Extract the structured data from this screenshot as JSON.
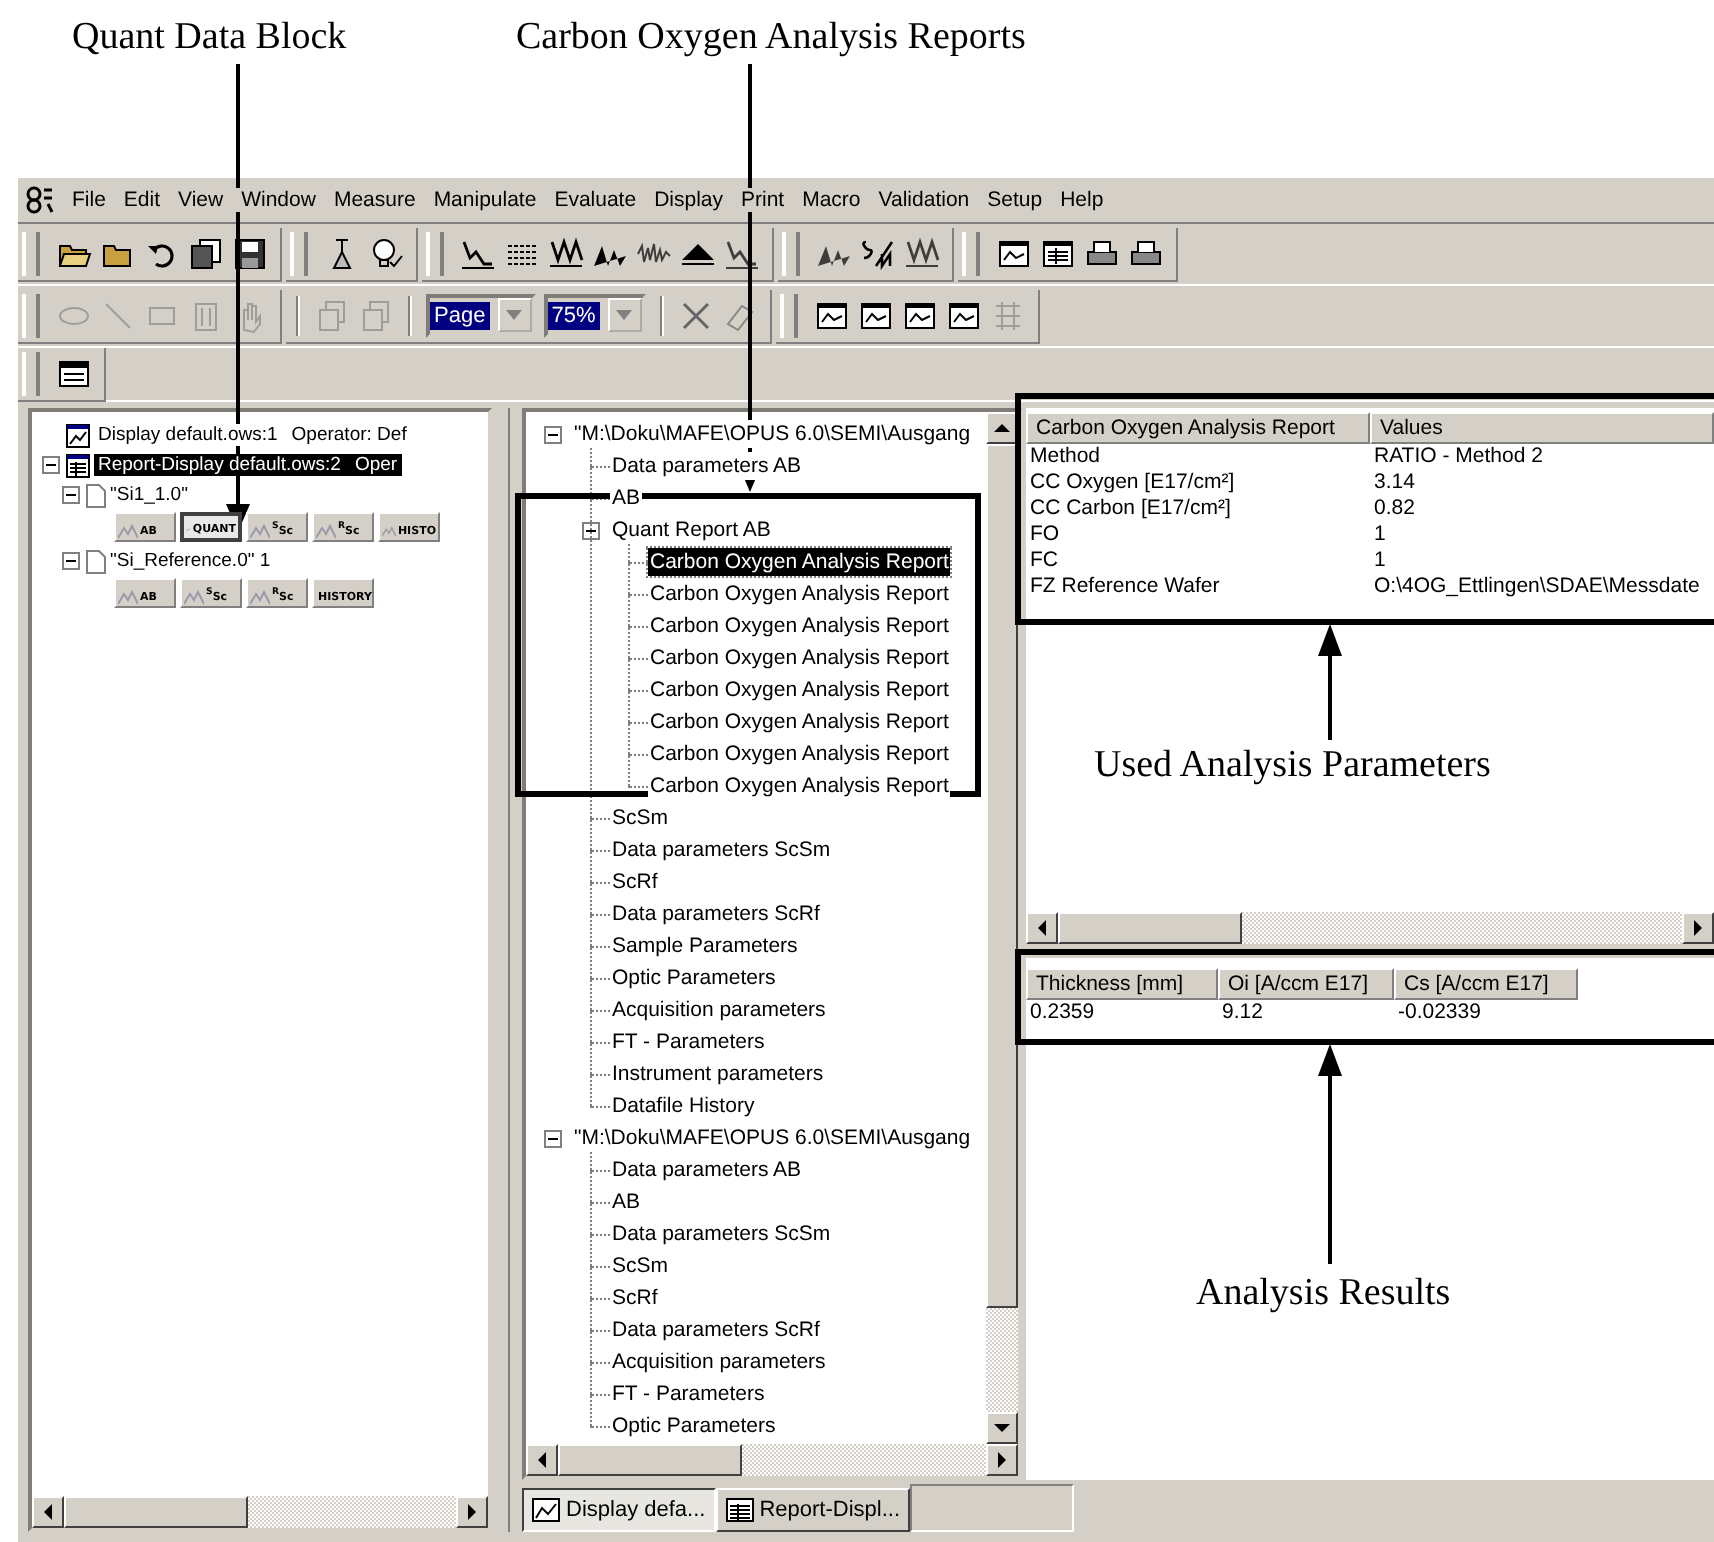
{
  "annotations": [
    {
      "label": "Quant Data Block"
    },
    {
      "label": "Carbon Oxygen Analysis Reports"
    },
    {
      "label": "Used Analysis Parameters"
    },
    {
      "label": "Analysis Results"
    }
  ],
  "menu": [
    {
      "label": "File"
    },
    {
      "label": "Edit"
    },
    {
      "label": "View"
    },
    {
      "label": "Window"
    },
    {
      "label": "Measure"
    },
    {
      "label": "Manipulate"
    },
    {
      "label": "Evaluate"
    },
    {
      "label": "Display"
    },
    {
      "label": "Print"
    },
    {
      "label": "Macro"
    },
    {
      "label": "Validation"
    },
    {
      "label": "Setup"
    },
    {
      "label": "Help"
    }
  ],
  "toolbar": {
    "layout_dropdown": "Page",
    "zoom_dropdown": "75%"
  },
  "left_tree": [
    {
      "label": "Display default.ows:1",
      "operator": "Operator: Def",
      "selected": false,
      "kind": "display"
    },
    {
      "label": "Report-Display default.ows:2",
      "operator": "Oper",
      "selected": true,
      "expanded": true,
      "kind": "report",
      "children": [
        {
          "label": "\"Si1_1.0\"",
          "expanded": true,
          "buttons": [
            {
              "label": "AB",
              "selected": false
            },
            {
              "label": "QUANT",
              "selected": true
            },
            {
              "label": "$^{S}$Sc",
              "selected": false
            },
            {
              "label": "$^{R}$Sc",
              "selected": false
            },
            {
              "label": "HISTO",
              "selected": false
            }
          ]
        },
        {
          "label": "\"Si_Reference.0\" 1",
          "expanded": true,
          "buttons": [
            {
              "label": "AB",
              "selected": false
            },
            {
              "label": "$^{S}$Sc",
              "selected": false
            },
            {
              "label": "$^{R}$Sc",
              "selected": false
            },
            {
              "label": "HISTORY",
              "selected": false
            }
          ]
        }
      ]
    }
  ],
  "file_tree": [
    {
      "label": "\"M:\\Doku\\MAFE\\OPUS 6.0\\SEMI\\Ausgang",
      "selected": false,
      "expanded": true,
      "children": [
        {
          "label": "Data parameters AB",
          "selected": false
        },
        {
          "label": "AB",
          "selected": false
        },
        {
          "label": "Quant Report AB",
          "selected": false,
          "expanded": true,
          "children": [
            {
              "label": "Carbon Oxygen Analysis Report",
              "selected": true
            },
            {
              "label": "Carbon Oxygen Analysis Report",
              "selected": false
            },
            {
              "label": "Carbon Oxygen Analysis Report",
              "selected": false
            },
            {
              "label": "Carbon Oxygen Analysis Report",
              "selected": false
            },
            {
              "label": "Carbon Oxygen Analysis Report",
              "selected": false
            },
            {
              "label": "Carbon Oxygen Analysis Report",
              "selected": false
            },
            {
              "label": "Carbon Oxygen Analysis Report",
              "selected": false
            },
            {
              "label": "Carbon Oxygen Analysis Report",
              "selected": false
            }
          ]
        },
        {
          "label": "ScSm",
          "selected": false
        },
        {
          "label": "Data parameters ScSm",
          "selected": false
        },
        {
          "label": "ScRf",
          "selected": false
        },
        {
          "label": "Data parameters ScRf",
          "selected": false
        },
        {
          "label": "Sample Parameters",
          "selected": false
        },
        {
          "label": "Optic Parameters",
          "selected": false
        },
        {
          "label": "Acquisition parameters",
          "selected": false
        },
        {
          "label": "FT - Parameters",
          "selected": false
        },
        {
          "label": "Instrument parameters",
          "selected": false
        },
        {
          "label": "Datafile History",
          "selected": false
        }
      ]
    },
    {
      "label": "\"M:\\Doku\\MAFE\\OPUS 6.0\\SEMI\\Ausgang",
      "selected": false,
      "expanded": true,
      "children": [
        {
          "label": "Data parameters AB",
          "selected": false
        },
        {
          "label": "AB",
          "selected": false
        },
        {
          "label": "Data parameters ScSm",
          "selected": false
        },
        {
          "label": "ScSm",
          "selected": false
        },
        {
          "label": "ScRf",
          "selected": false
        },
        {
          "label": "Data parameters ScRf",
          "selected": false
        },
        {
          "label": "Acquisition parameters",
          "selected": false
        },
        {
          "label": "FT - Parameters",
          "selected": false
        },
        {
          "label": "Optic Parameters",
          "selected": false
        }
      ]
    }
  ],
  "report_table": {
    "columns": [
      "Carbon Oxygen Analysis Report",
      "Values"
    ],
    "rows": [
      [
        "Method",
        "RATIO - Method 2"
      ],
      [
        "CC Oxygen [E17/cm²]",
        "3.14"
      ],
      [
        "CC Carbon [E17/cm²]",
        "0.82"
      ],
      [
        "FO",
        "1"
      ],
      [
        "FC",
        "1"
      ],
      [
        "FZ Reference Wafer",
        "O:\\4OG_Ettlingen\\SDAE\\Messdate"
      ]
    ]
  },
  "results_table": {
    "columns": [
      "Thickness [mm]",
      "Oi [A/ccm E17]",
      "Cs [A/ccm E17]"
    ],
    "rows": [
      [
        "0.2359",
        "9.12",
        "-0.02339"
      ]
    ]
  },
  "tabs": [
    {
      "label": "Display defa...",
      "selected": true,
      "kind": "display"
    },
    {
      "label": "Report-Displ...",
      "selected": false,
      "kind": "report"
    }
  ]
}
